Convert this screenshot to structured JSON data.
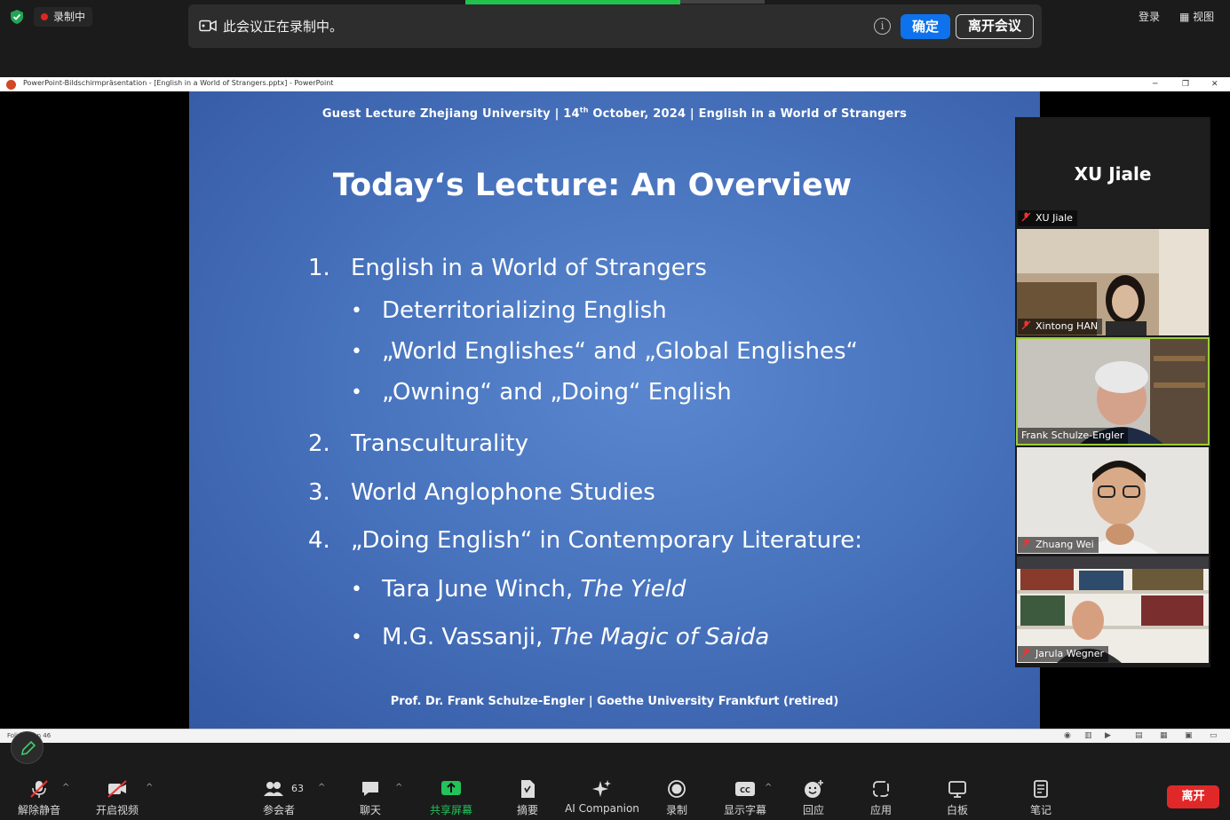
{
  "top": {
    "recording_label": "录制中",
    "banner_message": "此会议正在录制中。",
    "ok_button": "确定",
    "leave_meeting_button": "离开会议",
    "login": "登录",
    "view": "视图"
  },
  "ppt": {
    "window_title": "PowerPoint-Bildschirmpräsentation - [English in a World of Strangers.pptx] - PowerPoint",
    "status_text": "Folie 9 von 46"
  },
  "slide": {
    "header": "Guest Lecture Zhejiang University | 14th October, 2024 | English in a World of Strangers",
    "title": "Today‘s Lecture: An Overview",
    "items": [
      {
        "num": "1.",
        "text": "English in a World of Strangers"
      },
      {
        "bullet": "•",
        "text": "Deterritorializing English"
      },
      {
        "bullet": "•",
        "text": "„World Englishes“ and „Global Englishes“"
      },
      {
        "bullet": "•",
        "text": "„Owning“ and „Doing“ English"
      },
      {
        "num": "2.",
        "text": "Transculturality"
      },
      {
        "num": "3.",
        "text": "World Anglophone Studies"
      },
      {
        "num": "4.",
        "text": "„Doing English“ in Contemporary Literature:"
      },
      {
        "bullet": "•",
        "text": "Tara June Winch, ",
        "italic": "The Yield"
      },
      {
        "bullet": "•",
        "text": "M.G. Vassanji, ",
        "italic": "The Magic of Saida"
      }
    ],
    "footer": "Prof. Dr. Frank Schulze-Engler | Goethe University Frankfurt (retired)"
  },
  "participants": [
    {
      "name": "XU Jiale",
      "display": "XU Jiale",
      "muted": true
    },
    {
      "name": "Xintong HAN",
      "muted": true
    },
    {
      "name": "Frank Schulze-Engler",
      "muted": false
    },
    {
      "name": "Zhuang Wei",
      "muted": true
    },
    {
      "name": "Jarula Wegner",
      "muted": true
    }
  ],
  "toolbar": {
    "unmute": "解除静音",
    "start_video": "开启视频",
    "participants": "参会者",
    "participant_count": "63",
    "chat": "聊天",
    "share_screen": "共享屏幕",
    "summary": "摘要",
    "ai_companion": "AI Companion",
    "record": "录制",
    "captions": "显示字幕",
    "reactions": "回应",
    "apps": "应用",
    "whiteboard": "白板",
    "notes": "笔记",
    "leave": "离开"
  },
  "colors": {
    "accent_blue": "#0e72ed",
    "share_green": "#20c24c",
    "leave_red": "#e02828",
    "slide_blue": "#4a76c0"
  }
}
